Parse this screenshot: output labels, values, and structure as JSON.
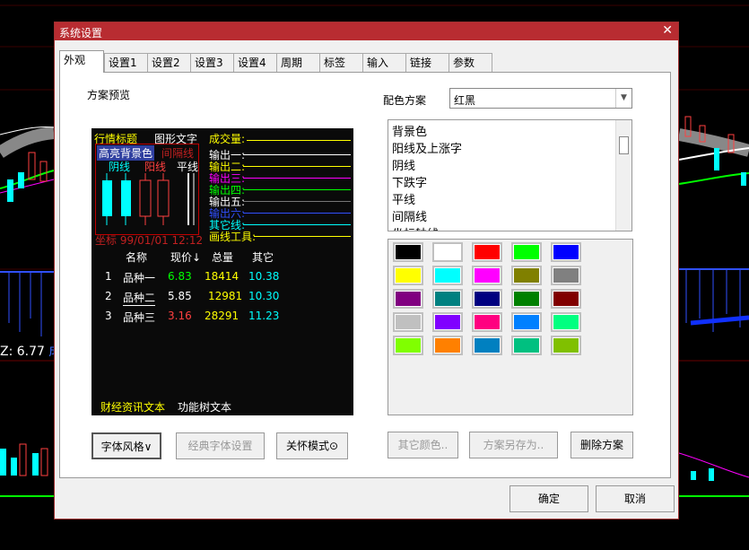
{
  "background": {
    "indicator_text": "Z: 6.77",
    "indicator_suffix": "成"
  },
  "dialog": {
    "title": "系统设置",
    "close_glyph": "✕",
    "tabs": [
      "外观",
      "设置1",
      "设置2",
      "设置3",
      "设置4",
      "周期",
      "标签",
      "输入",
      "链接",
      "参数"
    ],
    "active_tab": "外观"
  },
  "preview": {
    "section_label": "方案预览",
    "title_text": "行情标题",
    "graphic_text": "图形文字",
    "highlight_bg": "高亮背景色",
    "interval_line": "间隔线",
    "yang_line": "阳线",
    "yin_line": "阴线",
    "flat_line": "平线",
    "volume": "成交量:",
    "outputs": [
      "输出一:",
      "输出二:",
      "输出三:",
      "输出四:",
      "输出五:",
      "输出六:",
      "其它线:",
      "画线工具:"
    ],
    "coordinate": "坐标 99/01/01 12:12",
    "table_headers": [
      "名称",
      "现价↓",
      "总量",
      "其它"
    ],
    "rows": [
      {
        "idx": "1",
        "name": "品种一",
        "price": "6.83",
        "vol": "18414",
        "other": "10.38"
      },
      {
        "idx": "2",
        "name": "品种二",
        "price": "5.85",
        "vol": "12981",
        "other": "10.30"
      },
      {
        "idx": "3",
        "name": "品种三",
        "price": "3.16",
        "vol": "28291",
        "other": "11.23"
      }
    ],
    "news_text": "财经资讯文本",
    "tree_text": "功能树文本"
  },
  "left_buttons": {
    "font_style": "字体风格∨",
    "classic_font": "经典字体设置",
    "care_mode": "关怀模式⊙"
  },
  "scheme": {
    "label": "配色方案",
    "value": "红黑",
    "items": [
      "背景色",
      "阳线及上涨字",
      "阴线",
      "下跌字",
      "平线",
      "间隔线",
      "坐标轴线"
    ]
  },
  "swatches": [
    "#000000",
    "#ffffff",
    "#ff0000",
    "#00ff00",
    "#0000ff",
    "#ffff00",
    "#00ffff",
    "#ff00ff",
    "#808000",
    "#808080",
    "#800080",
    "#008080",
    "#000080",
    "#008000",
    "#800000",
    "#c0c0c0",
    "#8000ff",
    "#ff0080",
    "#0080ff",
    "#00ff80",
    "#80ff00",
    "#ff8000",
    "#0080c0",
    "#00c080",
    "#80c000"
  ],
  "right_buttons": {
    "other_colors": "其它颜色..",
    "save_as": "方案另存为..",
    "delete": "删除方案"
  },
  "footer": {
    "ok": "确定",
    "cancel": "取消"
  }
}
